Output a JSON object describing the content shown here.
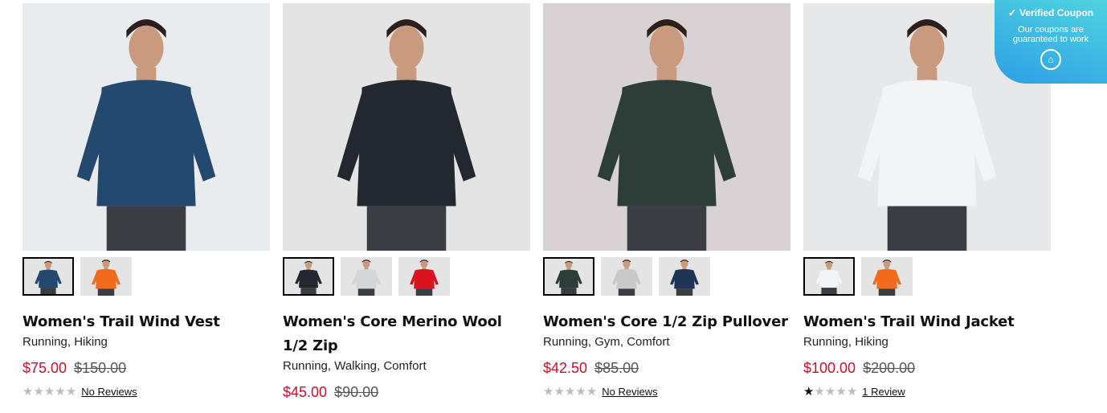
{
  "coupon": {
    "title": "Verified Coupon",
    "subtitle": "Our coupons are guaranteed to work",
    "check_icon": "check-circle-icon",
    "badge_icon": "house-badge-icon"
  },
  "products": [
    {
      "title": "Women's Trail Wind Vest",
      "tags": "Running, Hiking",
      "price": "$75.00",
      "original_price": "$150.00",
      "rating": 0,
      "reviews": "No Reviews",
      "bg": "#e9ecee",
      "garment": "#24496e",
      "thumbs": [
        "#24496e",
        "#f26b1d"
      ]
    },
    {
      "title": "Women's Core Merino Wool 1/2 Zip",
      "tags": "Running, Walking, Comfort",
      "price": "$45.00",
      "original_price": "$90.00",
      "rating": null,
      "reviews": "",
      "bg": "#e4e4e4",
      "garment": "#23282f",
      "thumbs": [
        "#23282f",
        "#d4d6da",
        "#d9141e"
      ]
    },
    {
      "title": "Women's Core 1/2 Zip Pullover",
      "tags": "Running, Gym, Comfort",
      "price": "$42.50",
      "original_price": "$85.00",
      "rating": 0,
      "reviews": "No Reviews",
      "bg": "#d9d2d4",
      "garment": "#2d3d38",
      "thumbs": [
        "#2d3d38",
        "#c9c9c9",
        "#1f3558"
      ]
    },
    {
      "title": "Women's Trail Wind Jacket",
      "tags": "Running, Hiking",
      "price": "$100.00",
      "original_price": "$200.00",
      "rating": 1,
      "reviews": "1 Review",
      "bg": "#e6e8ea",
      "garment": "#f2f4f8",
      "thumbs": [
        "#f2f4f8",
        "#f26b1d"
      ]
    }
  ]
}
